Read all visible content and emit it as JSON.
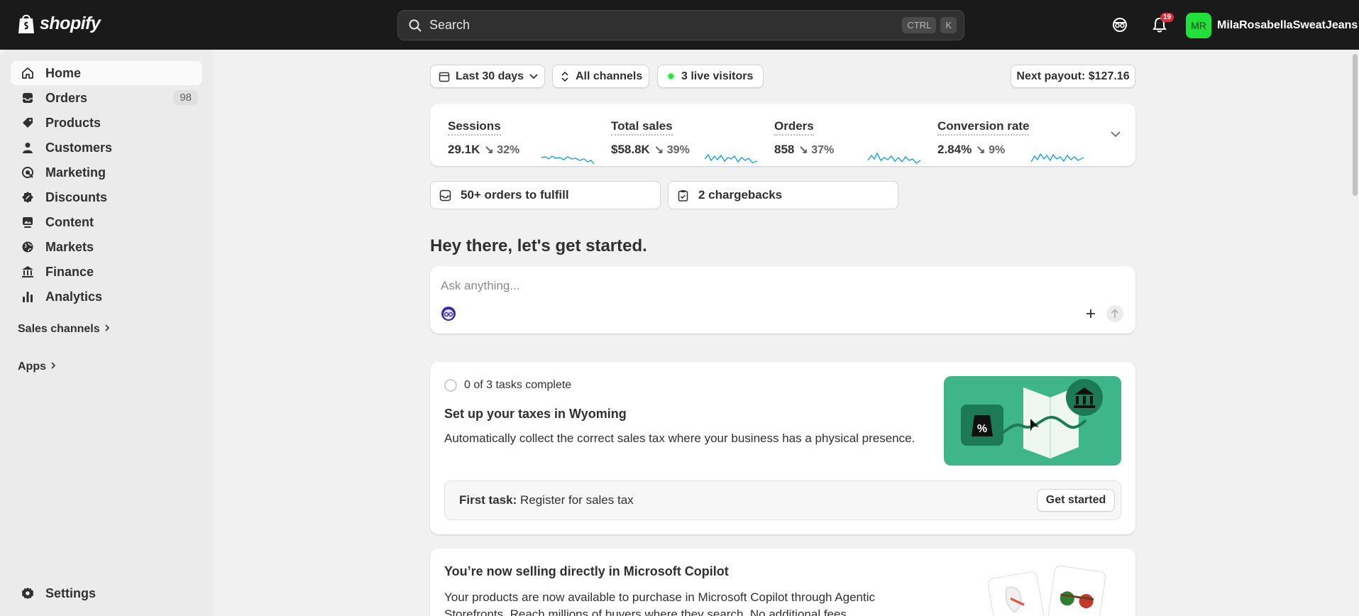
{
  "topbar": {
    "logo_text": "shopify",
    "search_placeholder": "Search",
    "search_key_1": "CTRL",
    "search_key_2": "K",
    "notification_count": "19",
    "avatar_initials": "MR",
    "account_name": "MilaRosabellaSweatJeans"
  },
  "sidebar": {
    "items": [
      {
        "label": "Home",
        "icon": "home-icon"
      },
      {
        "label": "Orders",
        "icon": "inbox-icon",
        "count": "98"
      },
      {
        "label": "Products",
        "icon": "tag-icon"
      },
      {
        "label": "Customers",
        "icon": "person-icon"
      },
      {
        "label": "Marketing",
        "icon": "target-icon"
      },
      {
        "label": "Discounts",
        "icon": "discount-icon"
      },
      {
        "label": "Content",
        "icon": "image-icon"
      },
      {
        "label": "Markets",
        "icon": "globe-icon"
      },
      {
        "label": "Finance",
        "icon": "bank-icon"
      },
      {
        "label": "Analytics",
        "icon": "bar-chart-icon"
      }
    ],
    "sales_channels": "Sales channels",
    "apps": "Apps",
    "settings": "Settings"
  },
  "filters": {
    "date_range": "Last 30 days",
    "channels": "All channels",
    "live_visitors": "3 live visitors",
    "payout": "Next payout: $127.16"
  },
  "metrics": [
    {
      "label": "Sessions",
      "value": "29.1K",
      "change": "32%"
    },
    {
      "label": "Total sales",
      "value": "$58.8K",
      "change": "39%"
    },
    {
      "label": "Orders",
      "value": "858",
      "change": "37%"
    },
    {
      "label": "Conversion rate",
      "value": "2.84%",
      "change": "9%"
    }
  ],
  "alerts": {
    "fulfill": "50+ orders to fulfill",
    "chargebacks": "2 chargebacks"
  },
  "greeting": "Hey there, let's get started.",
  "assistant": {
    "placeholder": "Ask anything..."
  },
  "setup": {
    "progress": "0 of 3 tasks complete",
    "title": "Set up your taxes in Wyoming",
    "description": "Automatically collect the correct sales tax where your business has a physical presence.",
    "first_task_label": "First task:",
    "first_task": "Register for sales tax",
    "cta": "Get started"
  },
  "copilot": {
    "title": "You’re now selling directly in Microsoft Copilot",
    "description_line1": "Your products are now available to purchase in Microsoft Copilot through Agentic",
    "description_line2": "Storefronts. Reach millions of buyers where they search. No additional fees."
  },
  "colors": {
    "topbar": "#1a1a1a",
    "accent_green": "#22e03a",
    "sparkline": "#1aa0e8",
    "tax_illustration": "#3fb58b"
  }
}
